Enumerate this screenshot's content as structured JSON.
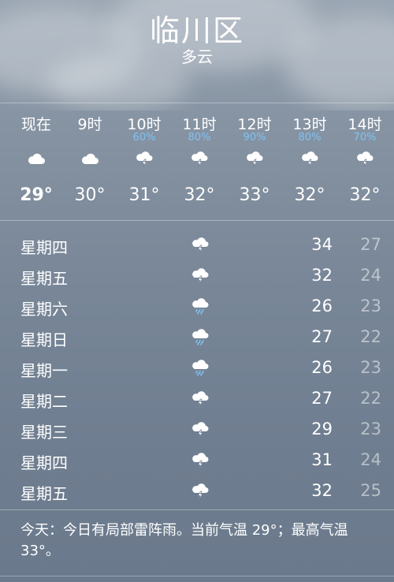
{
  "header": {
    "city": "临川区",
    "condition": "多云"
  },
  "hourly": [
    {
      "time": "现在",
      "pop": "",
      "icon": "cloudy-icon",
      "temp": "29°"
    },
    {
      "time": "9时",
      "pop": "",
      "icon": "cloudy-icon",
      "temp": "30°"
    },
    {
      "time": "10时",
      "pop": "60%",
      "icon": "thunderstorm-icon",
      "temp": "31°"
    },
    {
      "time": "11时",
      "pop": "80%",
      "icon": "thunderstorm-icon",
      "temp": "32°"
    },
    {
      "time": "12时",
      "pop": "90%",
      "icon": "thunderstorm-icon",
      "temp": "33°"
    },
    {
      "time": "13时",
      "pop": "80%",
      "icon": "thunderstorm-icon",
      "temp": "32°"
    },
    {
      "time": "14时",
      "pop": "70%",
      "icon": "thunderstorm-icon",
      "temp": "32°"
    }
  ],
  "daily": [
    {
      "day": "星期四",
      "icon": "thunderstorm-icon",
      "high": "34",
      "low": "27"
    },
    {
      "day": "星期五",
      "icon": "thunderstorm-icon",
      "high": "32",
      "low": "24"
    },
    {
      "day": "星期六",
      "icon": "rain-icon",
      "high": "26",
      "low": "23"
    },
    {
      "day": "星期日",
      "icon": "rain-icon",
      "high": "27",
      "low": "22"
    },
    {
      "day": "星期一",
      "icon": "rain-icon",
      "high": "26",
      "low": "23"
    },
    {
      "day": "星期二",
      "icon": "thunderstorm-icon",
      "high": "27",
      "low": "22"
    },
    {
      "day": "星期三",
      "icon": "thunderstorm-icon",
      "high": "29",
      "low": "23"
    },
    {
      "day": "星期四",
      "icon": "thunderstorm-icon",
      "high": "31",
      "low": "24"
    },
    {
      "day": "星期五",
      "icon": "thunderstorm-icon",
      "high": "32",
      "low": "25"
    }
  ],
  "summary": "今天：今日有局部雷阵雨。当前气温 29°；最高气温 33°。",
  "colors": {
    "precip": "#7fc3f2",
    "text": "#ffffff",
    "low_temp": "rgba(255,255,255,0.5)"
  }
}
